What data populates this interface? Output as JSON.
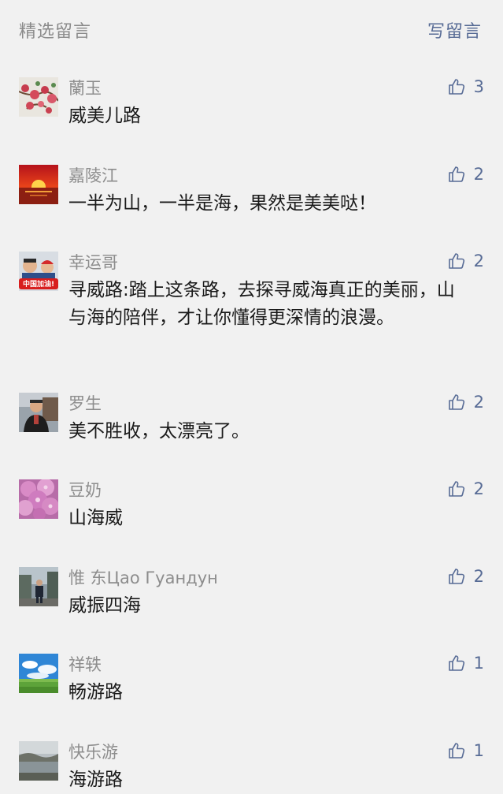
{
  "header": {
    "title": "精选留言",
    "write_label": "写留言"
  },
  "comments": [
    {
      "nickname": "蘭玉",
      "content": "威美儿路",
      "likes": "3",
      "avatar": "plum-blossom-avatar"
    },
    {
      "nickname": "嘉陵江",
      "content": "一半为山，一半是海，果然是美美哒！",
      "likes": "2",
      "avatar": "sunset-avatar"
    },
    {
      "nickname": "幸运哥",
      "content": "寻威路:踏上这条路，去探寻威海真正的美丽，山与海的陪伴，才让你懂得更深情的浪漫。",
      "likes": "2",
      "avatar": "china-cheer-avatar",
      "avatar_text": "中国加油!"
    },
    {
      "nickname": "罗生",
      "content": "美不胜收，太漂亮了。",
      "likes": "2",
      "avatar": "portrait-avatar"
    },
    {
      "nickname": "豆奶",
      "content": "山海威",
      "likes": "2",
      "avatar": "pink-flower-avatar"
    },
    {
      "nickname": "惟 东Цао Гуандун",
      "content": "威振四海",
      "likes": "2",
      "avatar": "standing-man-avatar"
    },
    {
      "nickname": "祥轶",
      "content": "畅游路",
      "likes": "1",
      "avatar": "blue-sky-avatar"
    },
    {
      "nickname": "快乐游",
      "content": "海游路",
      "likes": "1",
      "avatar": "coast-avatar"
    }
  ],
  "colors": {
    "background": "#f1f1f1",
    "link": "#576b95",
    "nickname": "#8d8d8d",
    "content": "#1a1a1a"
  },
  "icons": {
    "like": "thumbs-up-icon"
  }
}
